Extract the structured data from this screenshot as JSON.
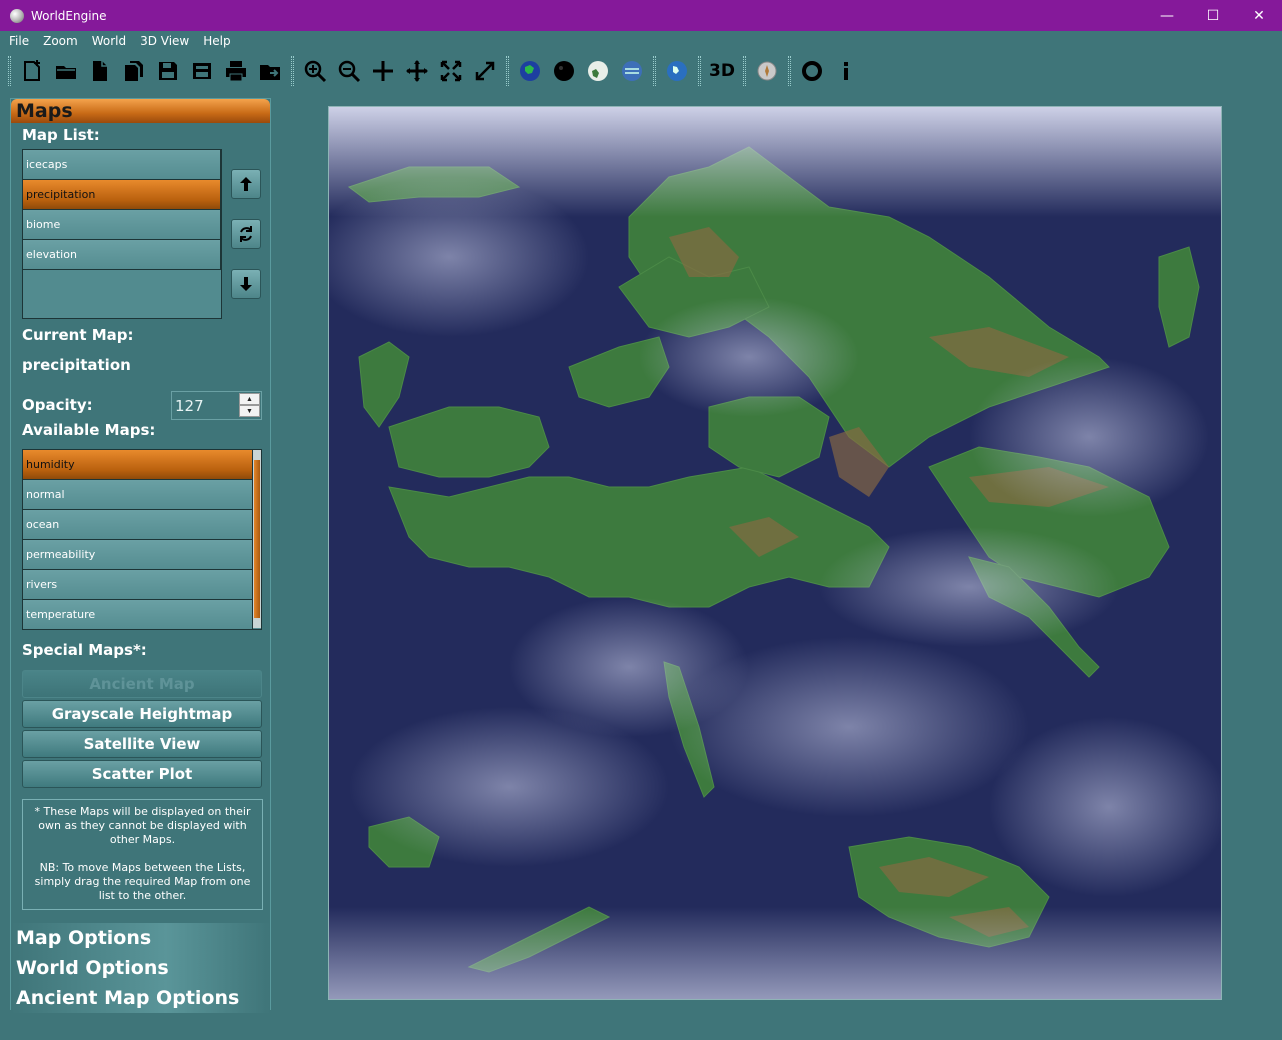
{
  "window": {
    "title": "WorldEngine",
    "controls": {
      "minimize": "—",
      "maximize": "☐",
      "close": "✕"
    }
  },
  "menu": [
    "File",
    "Zoom",
    "World",
    "3D View",
    "Help"
  ],
  "toolbar": {
    "icons": [
      "new-world-icon",
      "open-icon",
      "new-file-icon",
      "copy-icon",
      "save-icon",
      "save-as-icon",
      "print-icon",
      "export-icon",
      "zoom-in-icon",
      "zoom-out-icon",
      "pan-icon",
      "move-icon",
      "fit-icon",
      "fullscreen-icon",
      "globe-green-icon",
      "globe-dark-icon",
      "globe-white-icon",
      "globe-blue-icon",
      "globe-ocean-icon",
      "3d-icon",
      "compass-icon",
      "help-icon",
      "info-icon"
    ],
    "three_d_label": "3D"
  },
  "maps_panel": {
    "header": "Maps",
    "map_list_label": "Map List:",
    "map_list": [
      "icecaps",
      "precipitation",
      "biome",
      "elevation"
    ],
    "map_list_selected": "precipitation",
    "current_map_label": "Current Map:",
    "current_map": "precipitation",
    "opacity_label": "Opacity:",
    "opacity_value": "127",
    "available_maps_label": "Available Maps:",
    "available_maps": [
      "humidity",
      "normal",
      "ocean",
      "permeability",
      "rivers",
      "temperature"
    ],
    "available_selected": "humidity",
    "special_maps_label": "Special Maps*:",
    "special_buttons": [
      "Ancient Map",
      "Grayscale Heightmap",
      "Satellite View",
      "Scatter Plot"
    ],
    "note_line1": "* These Maps will be displayed on their own as they cannot be displayed with other Maps.",
    "note_line2": "NB: To move Maps between the Lists, simply drag the required Map from one list to the other."
  },
  "sections": [
    "Map Options",
    "World Options",
    "Ancient Map Options"
  ],
  "colors": {
    "titlebar": "#85199a",
    "background": "#3f7579",
    "accent_orange": "#c86a16",
    "ocean": "#222a58",
    "land": "#3d7a3e"
  }
}
